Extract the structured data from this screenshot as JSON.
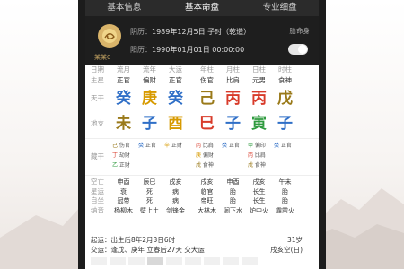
{
  "tabs": [
    {
      "label": "基本信息"
    },
    {
      "label": "基本命盘"
    },
    {
      "label": "专业细盘"
    }
  ],
  "profile": {
    "name": "某某0",
    "lunar": {
      "tag": "阴历：",
      "value": "1989年12月5日 子时（乾造）"
    },
    "solar": {
      "tag": "阳历：",
      "value": "1990年01月01日 00:00:00"
    },
    "toggle_label": "胎命身"
  },
  "grid": {
    "labels": {
      "date": "日期",
      "star": "主星",
      "stem": "天干",
      "branch": "地支",
      "hidden": "藏干",
      "kongwang": "空亡",
      "xingyun": "星运",
      "zizuo": "自坐",
      "nayin": "纳音"
    },
    "columns": [
      {
        "head": "流月",
        "star": "正官",
        "stem": "癸",
        "stem_el": "water",
        "branch": "未",
        "branch_el": "earth",
        "hidden": [
          "己 伤官",
          "丁 劫财",
          "乙 正财"
        ],
        "kongwang": "申酉",
        "xingyun": "衰",
        "zizuo": "冠带",
        "nayin": "杨柳木"
      },
      {
        "head": "流年",
        "star": "偏财",
        "stem": "庚",
        "stem_el": "metal",
        "branch": "子",
        "branch_el": "water",
        "hidden": [
          "癸 正官"
        ],
        "kongwang": "辰巳",
        "xingyun": "死",
        "zizuo": "死",
        "nayin": "壁上土"
      },
      {
        "head": "大运",
        "star": "正官",
        "stem": "癸",
        "stem_el": "water",
        "branch": "酉",
        "branch_el": "metal",
        "hidden": [
          "辛 正财"
        ],
        "kongwang": "戌亥",
        "xingyun": "病",
        "zizuo": "病",
        "nayin": "剑锋金"
      },
      {
        "head": "年柱",
        "star": "伤官",
        "stem": "己",
        "stem_el": "earth",
        "branch": "巳",
        "branch_el": "fire",
        "hidden": [
          "丙 比肩",
          "庚 偏财",
          "戊 食神"
        ],
        "kongwang": "戌亥",
        "xingyun": "临官",
        "zizuo": "帝旺",
        "nayin": "大林木"
      },
      {
        "head": "月柱",
        "star": "比肩",
        "stem": "丙",
        "stem_el": "fire",
        "branch": "子",
        "branch_el": "water",
        "hidden": [
          "癸 正官"
        ],
        "kongwang": "申酉",
        "xingyun": "胎",
        "zizuo": "胎",
        "nayin": "涧下水"
      },
      {
        "head": "日柱",
        "star": "元男",
        "stem": "丙",
        "stem_el": "fire",
        "branch": "寅",
        "branch_el": "wood",
        "hidden": [
          "甲 偏印",
          "丙 比肩",
          "戊 食神"
        ],
        "kongwang": "戌亥",
        "xingyun": "长生",
        "zizuo": "长生",
        "nayin": "炉中火"
      },
      {
        "head": "时柱",
        "star": "食神",
        "stem": "戊",
        "stem_el": "earth",
        "branch": "子",
        "branch_el": "water",
        "hidden": [
          "癸 正官"
        ],
        "kongwang": "午未",
        "xingyun": "胎",
        "zizuo": "胎",
        "nayin": "霹雳火"
      }
    ]
  },
  "bottom": {
    "qiyun": "起运：出生后8年2月3日6时",
    "age": "31岁",
    "jiaoyun": "交运：逢戊、庚年 立春后27天 交大运",
    "kongwang": "戌亥空(日)"
  },
  "colors": {
    "water": "#2f6fc7",
    "fire": "#d83b2a",
    "earth": "#9a7a1a",
    "metal": "#d79a00",
    "wood": "#2e9a3e"
  }
}
